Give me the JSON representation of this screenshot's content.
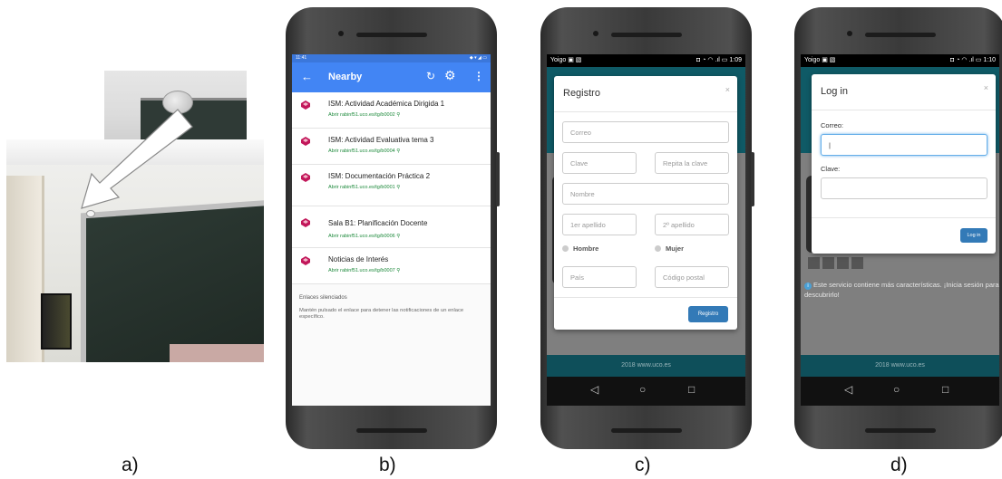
{
  "captions": {
    "a": "a)",
    "b": "b)",
    "c": "c)",
    "d": "d)"
  },
  "phone_b": {
    "status_time": "11:41",
    "status_icons": "◆ ▾ ◢ ▭",
    "appbar": {
      "back_icon": "←",
      "title": "Nearby",
      "refresh_icon": "↻",
      "settings_icon": "⚙",
      "more_icon": "⋮"
    },
    "items": [
      {
        "title": "ISM: Actividad Académica Dirigida 1",
        "url": "Abrir rabinf51.uco.es/tg/b0002 ⚲"
      },
      {
        "title": "ISM: Actividad Evaluativa tema 3",
        "url": "Abrir rabinf51.uco.es/tg/b0004 ⚲"
      },
      {
        "title": "ISM: Documentación Práctica 2",
        "url": "Abrir rabinf51.uco.es/tg/b0001 ⚲"
      },
      {
        "title": "Sala B1: Planificación Docente",
        "url": "Abrir rabinf51.uco.es/tg/b0006 ⚲"
      },
      {
        "title": "Noticias de Interés",
        "url": "Abrir rabinf51.uco.es/tg/b0007 ⚲"
      }
    ],
    "muted": {
      "heading": "Enlaces silenciados",
      "text": "Mantén pulsado el enlace para detener las notificaciones de un enlace específico."
    }
  },
  "phone_c": {
    "status_left": "Yoigo ▣ ▧",
    "status_right": "◘ ◔ ◠ .ıl ▭ 1:09",
    "modal_title": "Registro",
    "close": "×",
    "fields": {
      "correo": "Correo",
      "clave": "Clave",
      "repita": "Repita la clave",
      "nombre": "Nombre",
      "apellido1": "1er apellido",
      "apellido2": "2º apellido",
      "pais": "País",
      "cp": "Código postal"
    },
    "radio_hombre": "Hombre",
    "radio_mujer": "Mujer",
    "submit": "Registro",
    "footer": "2018 www.uco.es"
  },
  "phone_d": {
    "status_left": "Yoigo ▣ ▧",
    "status_right": "◘ ◔ ◠ .ıl ▭ 1:10",
    "modal_title": "Log in",
    "close": "×",
    "label_correo": "Correo:",
    "label_clave": "Clave:",
    "submit": "Log in",
    "info": "Este servicio contiene más características. ¡Inicia sesión para descubrirlo!",
    "info_icon": "i",
    "footer": "2018 www.uco.es"
  },
  "navbar": {
    "back": "◁",
    "home": "○",
    "recent": "□"
  },
  "colors": {
    "appbar": "#4285f4",
    "url_green": "#1e8a3c",
    "teal": "#0f5a66",
    "button_blue": "#337ab7"
  }
}
